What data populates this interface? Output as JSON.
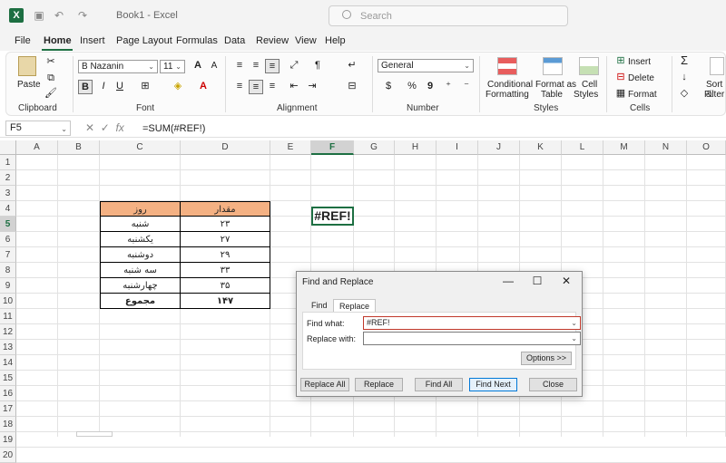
{
  "window": {
    "doc_title": "Book1 - Excel",
    "search_placeholder": "Search"
  },
  "menu": [
    "File",
    "Home",
    "Insert",
    "Page Layout",
    "Formulas",
    "Data",
    "Review",
    "View",
    "Help"
  ],
  "ribbon": {
    "clipboard": {
      "paste": "Paste",
      "group": "Clipboard"
    },
    "font": {
      "name": "B Nazanin",
      "size": "11",
      "group": "Font",
      "bold": "B",
      "italic": "I",
      "underline": "U",
      "grow": "A",
      "shrink": "A"
    },
    "alignment": {
      "group": "Alignment"
    },
    "number": {
      "format": "General",
      "group": "Number",
      "currency": "$",
      "percent": "%",
      "comma": "9"
    },
    "styles": {
      "conditional": "Conditional",
      "conditional2": "Formatting",
      "format_as": "Format as",
      "format_as2": "Table",
      "cell": "Cell",
      "cell2": "Styles",
      "group": "Styles"
    },
    "cells": {
      "insert": "Insert",
      "delete": "Delete",
      "format": "Format",
      "group": "Cells"
    },
    "editing": {
      "sort": "Sort &",
      "filter": "Filter",
      "sigma": "Σ"
    }
  },
  "formula_bar": {
    "name_box": "F5",
    "fx": "fx",
    "formula": "=SUM(#REF!)"
  },
  "columns": [
    "A",
    "B",
    "C",
    "D",
    "E",
    "F",
    "G",
    "H",
    "I",
    "J",
    "K",
    "L",
    "M",
    "N",
    "O"
  ],
  "rows": [
    "1",
    "2",
    "3",
    "4",
    "5",
    "6",
    "7",
    "8",
    "9",
    "10",
    "11",
    "12",
    "13",
    "14",
    "15",
    "16",
    "17",
    "18",
    "19",
    "20"
  ],
  "table": {
    "header": {
      "col_c": "روز",
      "col_d": "مقدار"
    },
    "rows": [
      {
        "c": "شنبه",
        "d": "۲۳"
      },
      {
        "c": "یکشنبه",
        "d": "۲۷"
      },
      {
        "c": "دوشنبه",
        "d": "۲۹"
      },
      {
        "c": "سه شنبه",
        "d": "۳۳"
      },
      {
        "c": "چهارشنبه",
        "d": "۳۵"
      }
    ],
    "total": {
      "c": "مجموع",
      "d": "۱۴۷"
    }
  },
  "active_cell_value": "#REF!",
  "dialog": {
    "title": "Find and Replace",
    "tab_find": "Find",
    "tab_replace": "Replace",
    "find_label": "Find what:",
    "find_value": "#REF!",
    "replace_label": "Replace with:",
    "replace_value": "",
    "options_btn": "Options >>",
    "replace_all_btn": "Replace All",
    "replace_btn": "Replace",
    "find_all_btn": "Find All",
    "find_next_btn": "Find Next",
    "close_btn": "Close"
  }
}
